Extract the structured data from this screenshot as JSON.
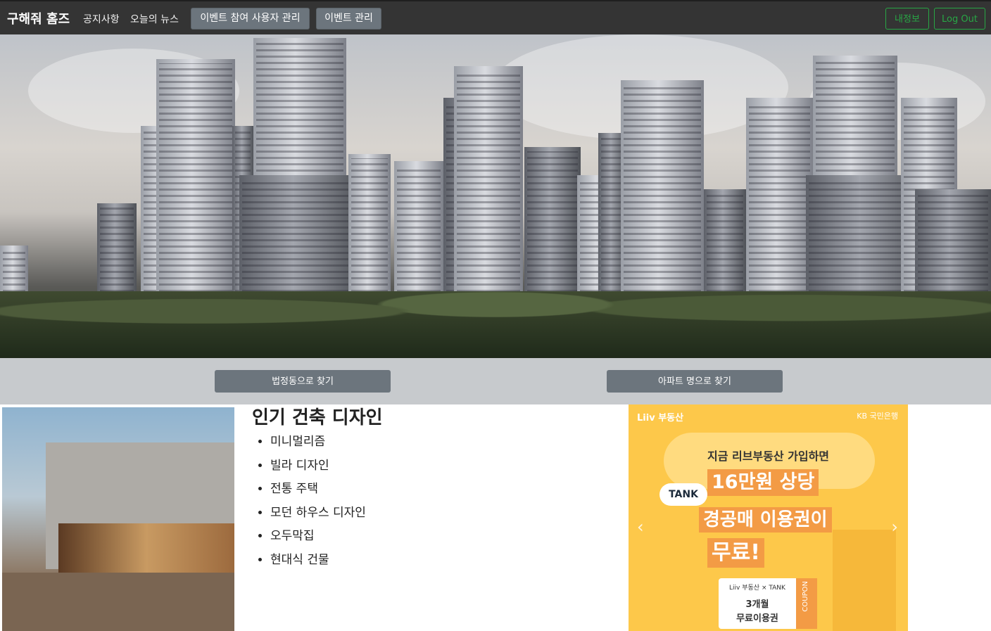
{
  "navbar": {
    "brand": "구해줘 홈즈",
    "links": [
      "공지사항",
      "오늘의 뉴스"
    ],
    "buttons": [
      "이벤트 참여 사용자 관리",
      "이벤트 관리"
    ],
    "right_buttons": [
      "내정보",
      "Log Out"
    ]
  },
  "search": {
    "by_dong": "법정동으로 찾기",
    "by_apt": "아파트 명으로 찾기"
  },
  "design_section": {
    "title": "인기 건축 디자인",
    "items": [
      "미니멀리즘",
      "빌라 디자인",
      "전통 주택",
      "모던 하우스 디자인",
      "오두막집",
      "현대식 건물"
    ]
  },
  "ad": {
    "logo_left": "Liiv 부동산",
    "logo_right": "KB 국민은행",
    "line1": "지금 리브부동산 가입하면",
    "highlight1": "16만원 상당",
    "highlight2": "경공매 이용권이",
    "highlight3": "무료!",
    "tank_badge": "TANK",
    "coupon_top": "Liiv 부동산 × TANK",
    "coupon_line1": "3개월",
    "coupon_line2": "무료이용권",
    "coupon_side": "COUPON",
    "prev_icon": "‹",
    "next_icon": "›"
  },
  "colors": {
    "navbar_bg": "#343434",
    "secondary_button": "#6c757d",
    "success_outline": "#28a745",
    "search_band": "#c7cacd",
    "ad_yellow": "#fdc84a",
    "ad_orange": "#f39b45"
  }
}
